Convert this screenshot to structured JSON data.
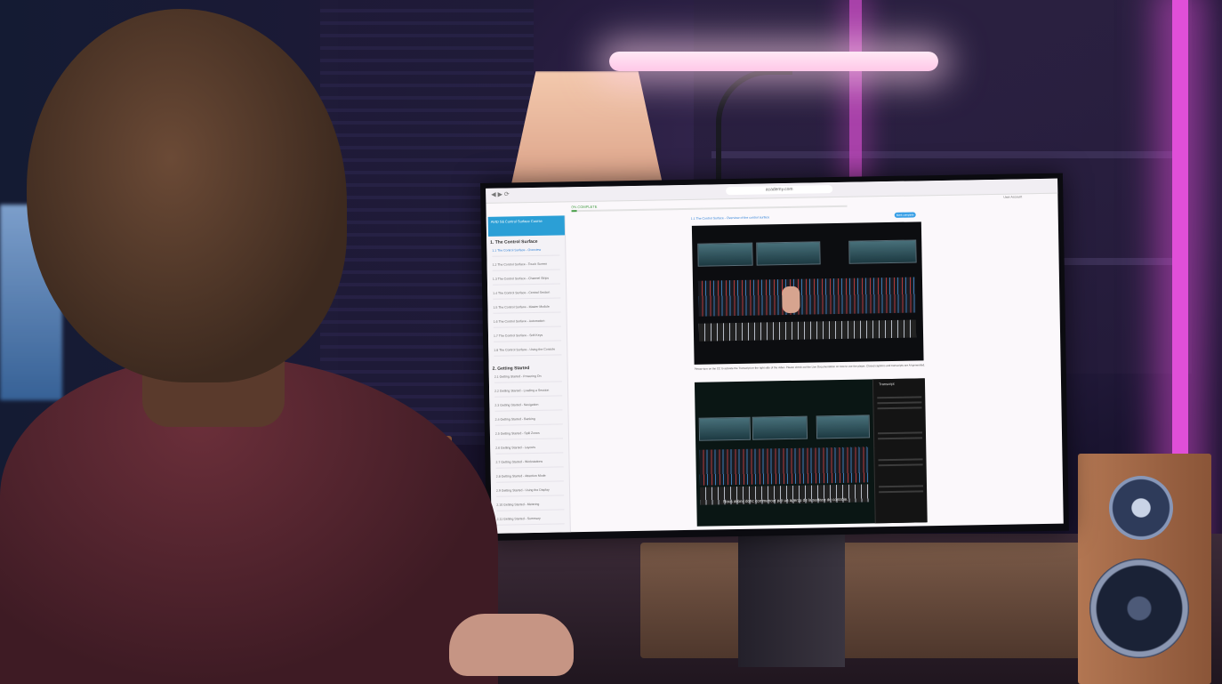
{
  "browser": {
    "url": "academy.com",
    "nav_icons": "◀ ▶ ⟳"
  },
  "course": {
    "progress_label": "0% COMPLETE",
    "progress_fraction": 0.02,
    "sidebar_header": "AVID S6 Control Surface Course",
    "sections": [
      {
        "title": "1. The Control Surface",
        "items": [
          "1.1 The Control Surface - Overview",
          "1.2 The Control Surface - Touch Screen",
          "1.3 The Control Surface - Channel Strips",
          "1.4 The Control Surface - Central Section",
          "1.5 The Control Surface - Master Module",
          "1.6 The Control Surface - Automation",
          "1.7 The Control Surface - Soft Keys",
          "1.8 The Control Surface - Using the Console"
        ]
      },
      {
        "title": "2. Getting Started",
        "items": [
          "2.1 Getting Started - Powering On",
          "2.2 Getting Started - Loading a Session",
          "2.3 Getting Started - Navigation",
          "2.4 Getting Started - Banking",
          "2.5 Getting Started - Spill Zones",
          "2.6 Getting Started - Layouts",
          "2.7 Getting Started - Workstations",
          "2.8 Getting Started - Attention Mode",
          "2.9 Getting Started - Using the Display",
          "2.10 Getting Started - Metering",
          "2.11 Getting Started - Summary"
        ]
      }
    ],
    "breadcrumb": "1.1 The Control Surface - Overview of the control surface",
    "pill_label": "Mark complete",
    "video_note": "Please turn on the CC to activate the Transcript on the right side of the video. Please check out the Live Documentation on how to use the player. Closed captions and transcripts are AI-generated.",
    "subtitle": "Nous allons donc commencer par un aperçu de la surface de contrôle.",
    "transcript_title": "Transcript",
    "user_label": "User Account"
  },
  "colors": {
    "accent": "#2b9fd6",
    "progress": "#4aa04a",
    "neon": "#e04fd8"
  }
}
